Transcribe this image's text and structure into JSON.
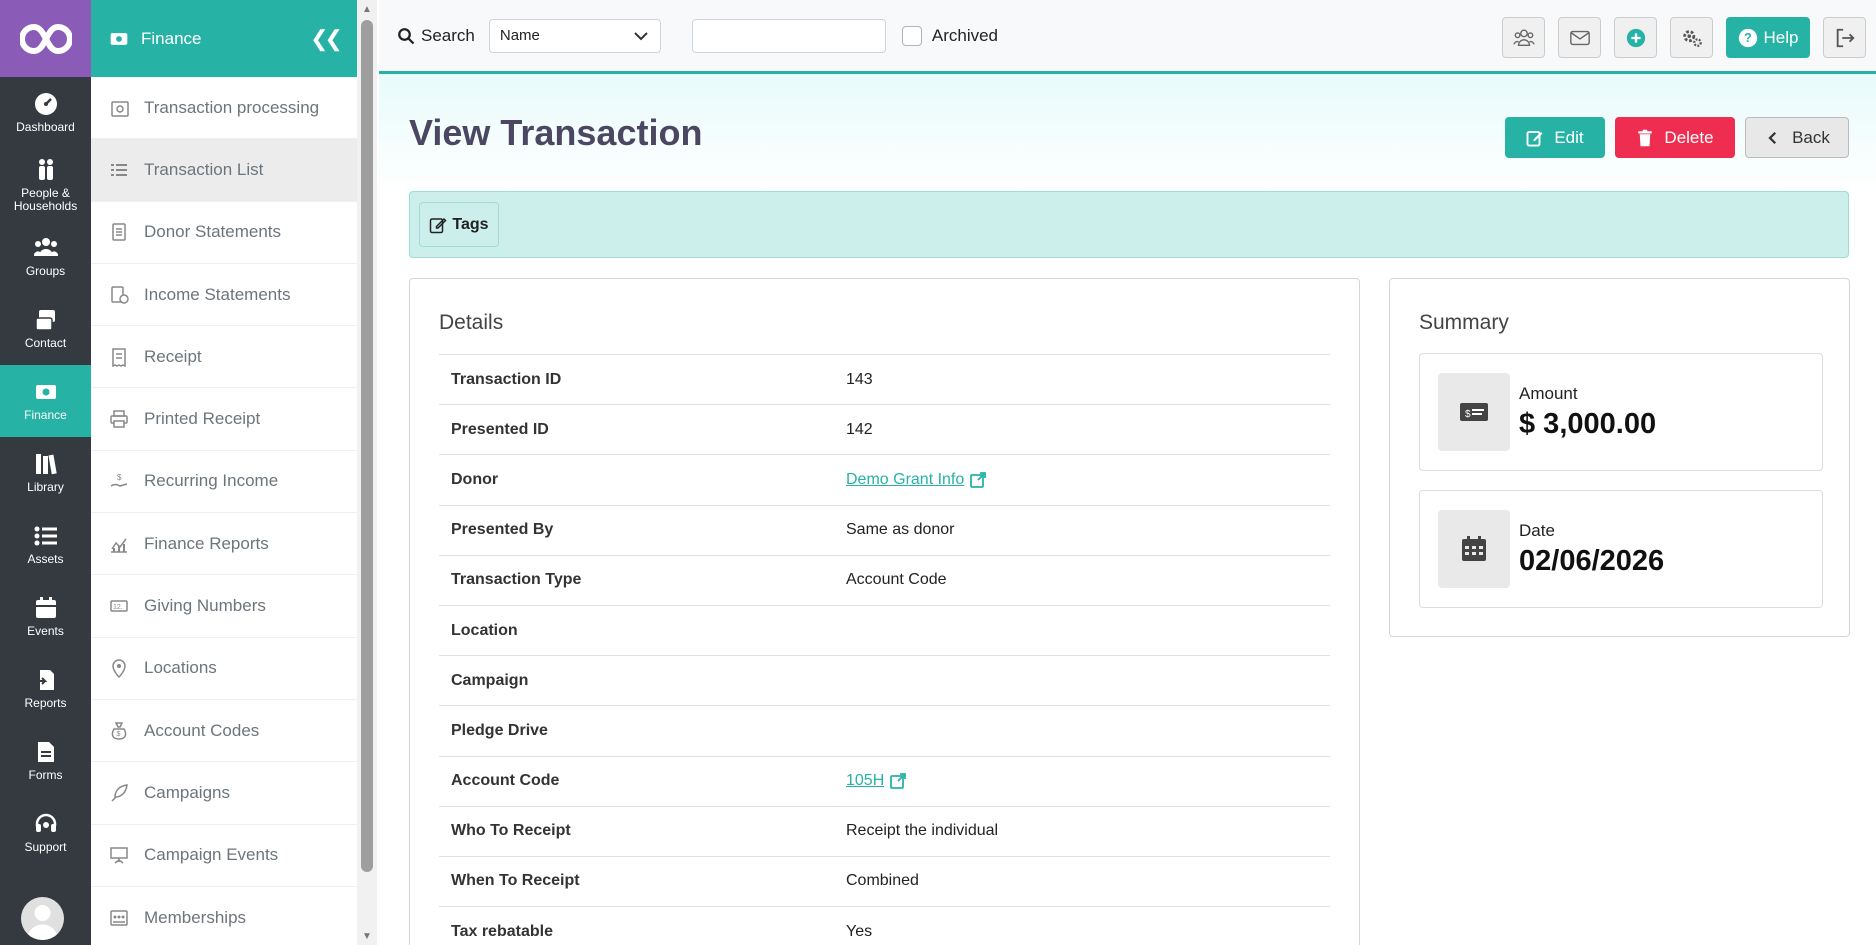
{
  "rail": {
    "items": [
      {
        "label": "Dashboard",
        "icon": "dashboard-icon"
      },
      {
        "label": "People & Households",
        "icon": "people-icon"
      },
      {
        "label": "Groups",
        "icon": "groups-icon"
      },
      {
        "label": "Contact",
        "icon": "contact-icon"
      },
      {
        "label": "Finance",
        "icon": "finance-icon"
      },
      {
        "label": "Library",
        "icon": "library-icon"
      },
      {
        "label": "Assets",
        "icon": "assets-icon"
      },
      {
        "label": "Events",
        "icon": "events-icon"
      },
      {
        "label": "Reports",
        "icon": "reports-icon"
      },
      {
        "label": "Forms",
        "icon": "forms-icon"
      },
      {
        "label": "Support",
        "icon": "support-icon"
      }
    ]
  },
  "submenu": {
    "title": "Finance",
    "items": [
      {
        "label": "Transaction processing",
        "icon": "transaction-processing-icon"
      },
      {
        "label": "Transaction List",
        "icon": "list-icon"
      },
      {
        "label": "Donor Statements",
        "icon": "document-icon"
      },
      {
        "label": "Income Statements",
        "icon": "income-statement-icon"
      },
      {
        "label": "Receipt",
        "icon": "receipt-icon"
      },
      {
        "label": "Printed Receipt",
        "icon": "printer-icon"
      },
      {
        "label": "Recurring Income",
        "icon": "hand-dollar-icon"
      },
      {
        "label": "Finance Reports",
        "icon": "chart-icon"
      },
      {
        "label": "Giving Numbers",
        "icon": "numbers-icon"
      },
      {
        "label": "Locations",
        "icon": "location-pin-icon"
      },
      {
        "label": "Account Codes",
        "icon": "money-bag-icon"
      },
      {
        "label": "Campaigns",
        "icon": "rocket-icon"
      },
      {
        "label": "Campaign Events",
        "icon": "presentation-icon"
      },
      {
        "label": "Memberships",
        "icon": "memberships-icon"
      }
    ]
  },
  "topbar": {
    "search_label": "Search",
    "select_value": "Name",
    "search_value": "",
    "archived_label": "Archived",
    "help_label": "Help"
  },
  "page": {
    "title": "View Transaction",
    "edit_label": "Edit",
    "delete_label": "Delete",
    "back_label": "Back",
    "tags_label": "Tags"
  },
  "details": {
    "title": "Details",
    "rows": [
      {
        "label": "Transaction ID",
        "value": "143"
      },
      {
        "label": "Presented ID",
        "value": "142"
      },
      {
        "label": "Donor",
        "value": "Demo Grant Info"
      },
      {
        "label": "Presented By",
        "value": "Same as donor"
      },
      {
        "label": "Transaction Type",
        "value": "Account Code"
      },
      {
        "label": "Location",
        "value": ""
      },
      {
        "label": "Campaign",
        "value": ""
      },
      {
        "label": "Pledge Drive",
        "value": ""
      },
      {
        "label": "Account Code",
        "value": "105H"
      },
      {
        "label": "Who To Receipt",
        "value": "Receipt the individual"
      },
      {
        "label": "When To Receipt",
        "value": "Combined"
      },
      {
        "label": "Tax rebatable",
        "value": "Yes"
      }
    ]
  },
  "summary": {
    "title": "Summary",
    "amount_label": "Amount",
    "amount_value": "$ 3,000.00",
    "date_label": "Date",
    "date_value": "02/06/2026"
  },
  "colors": {
    "accent": "#26b3a6",
    "rail": "#343a40",
    "logo": "#8a5cb8",
    "danger": "#ee2d50"
  }
}
